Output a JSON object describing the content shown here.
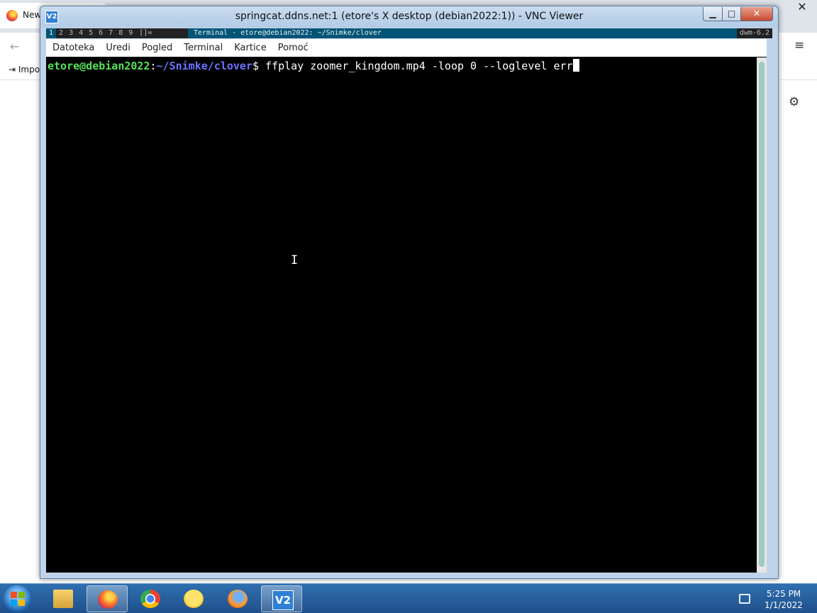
{
  "browser": {
    "tab_title": "New",
    "close_glyph": "✕",
    "back_glyph": "←",
    "menu_glyph": "≡",
    "bookmark_label": "Impo",
    "gear_glyph": "⚙"
  },
  "vnc": {
    "icon_text": "V2",
    "title": "springcat.ddns.net:1 (etore's X desktop (debian2022:1)) - VNC Viewer",
    "min_glyph": "▁",
    "max_glyph": "□",
    "close_glyph": "✕"
  },
  "dwm": {
    "tags": [
      "1",
      "2",
      "3",
      "4",
      "5",
      "6",
      "7",
      "8",
      "9"
    ],
    "layout": "[]=",
    "window_title": "Terminal - etore@debian2022: ~/Snimke/clover",
    "status": "dwm-6.2"
  },
  "terminal": {
    "menu": [
      "Datoteka",
      "Uredi",
      "Pogled",
      "Terminal",
      "Kartice",
      "Pomoć"
    ],
    "prompt_user": "etore@debian2022",
    "prompt_sep": ":",
    "prompt_path": "~/Snimke/clover",
    "prompt_symbol": "$",
    "command": " ffplay zoomer_kingdom.mp4 -loop 0 --loglevel err",
    "ibeam_glyph": "I"
  },
  "taskbar": {
    "vnc_icon_text": "V2",
    "clock_time": "5:25 PM",
    "clock_date": "1/1/2022"
  },
  "colors": {
    "prompt_user": "#55e35a",
    "prompt_path": "#6c73ff",
    "dwm_selected": "#005577"
  }
}
